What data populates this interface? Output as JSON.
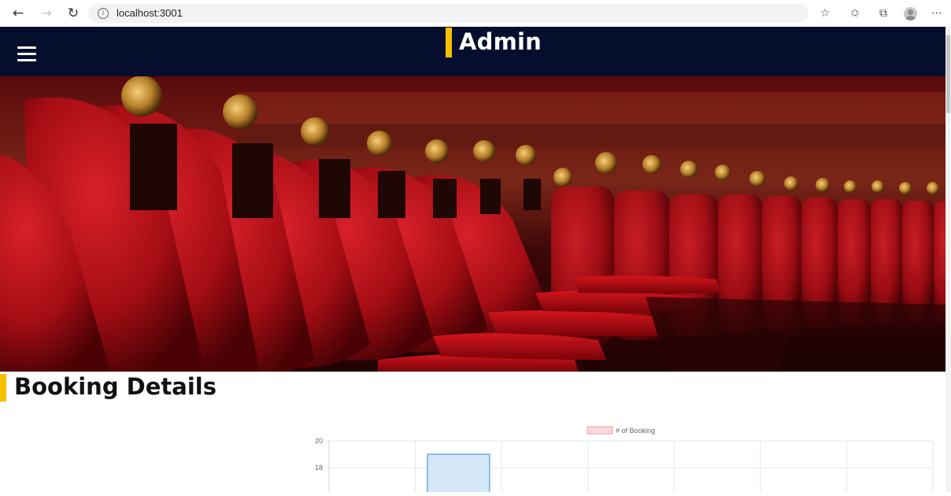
{
  "browser": {
    "url": "localhost:3001",
    "info_icon_glyph": "i",
    "back_icon": "←",
    "forward_icon": "→",
    "reload_icon": "↻",
    "right_icons": [
      "☆",
      "✩",
      "⧉",
      "⋯"
    ]
  },
  "header": {
    "title": "Admin",
    "menu_icon": "hamburger-menu-icon",
    "accent_color": "#f5c000",
    "background_color": "#050f2d"
  },
  "hero": {
    "image": "theatre-seats-photo"
  },
  "booking": {
    "title": "Booking Details"
  },
  "chart_data": {
    "type": "bar",
    "legend": "# of Booking",
    "legend_placement": "top",
    "y_ticks": [
      "20",
      "18"
    ],
    "ylim": [
      16,
      20
    ],
    "categories": [
      "",
      "",
      "",
      "",
      "",
      "",
      ""
    ],
    "values": [
      null,
      19,
      null,
      null,
      null,
      null,
      null
    ],
    "bar_color": "#d6e9f8",
    "bar_border_color": "#6aaedb",
    "legend_color": "#fbd9de",
    "legend_border_color": "#f29aa7",
    "grid": true
  }
}
